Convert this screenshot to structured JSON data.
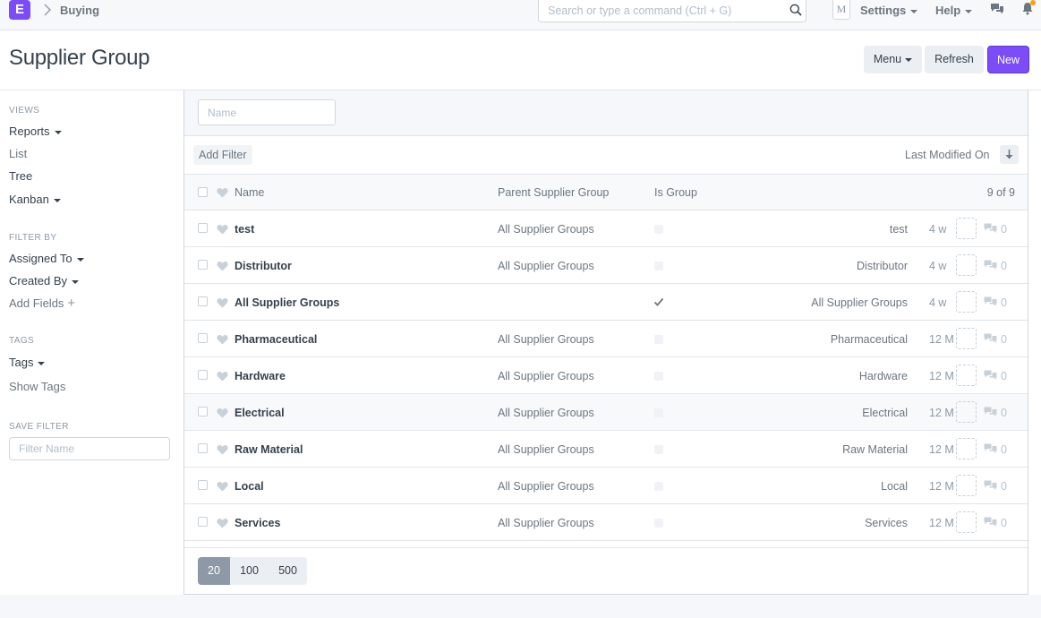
{
  "navbar": {
    "logo_letter": "E",
    "breadcrumb": "Buying",
    "search_placeholder": "Search or type a command (Ctrl + G)",
    "avatar_initial": "M",
    "settings_label": "Settings",
    "help_label": "Help"
  },
  "page": {
    "title": "Supplier Group",
    "menu_label": "Menu",
    "refresh_label": "Refresh",
    "new_label": "New"
  },
  "sidebar": {
    "views_heading": "VIEWS",
    "reports": "Reports",
    "list": "List",
    "tree": "Tree",
    "kanban": "Kanban",
    "filter_heading": "FILTER BY",
    "assigned_to": "Assigned To",
    "created_by": "Created By",
    "add_fields": "Add Fields",
    "tags_heading": "TAGS",
    "tags": "Tags",
    "show_tags": "Show Tags",
    "save_filter_heading": "SAVE FILTER",
    "filter_name_placeholder": "Filter Name"
  },
  "list": {
    "name_filter_placeholder": "Name",
    "add_filter": "Add Filter",
    "sort_label": "Last Modified On",
    "columns": {
      "name": "Name",
      "parent": "Parent Supplier Group",
      "is_group": "Is Group",
      "count": "9 of 9"
    },
    "rows": [
      {
        "name": "test",
        "parent": "All Supplier Groups",
        "is_group": false,
        "title": "test",
        "modified": "4 w",
        "comments": "0"
      },
      {
        "name": "Distributor",
        "parent": "All Supplier Groups",
        "is_group": false,
        "title": "Distributor",
        "modified": "4 w",
        "comments": "0"
      },
      {
        "name": "All Supplier Groups",
        "parent": "",
        "is_group": true,
        "title": "All Supplier Groups",
        "modified": "4 w",
        "comments": "0"
      },
      {
        "name": "Pharmaceutical",
        "parent": "All Supplier Groups",
        "is_group": false,
        "title": "Pharmaceutical",
        "modified": "12 M",
        "comments": "0"
      },
      {
        "name": "Hardware",
        "parent": "All Supplier Groups",
        "is_group": false,
        "title": "Hardware",
        "modified": "12 M",
        "comments": "0"
      },
      {
        "name": "Electrical",
        "parent": "All Supplier Groups",
        "is_group": false,
        "title": "Electrical",
        "modified": "12 M",
        "comments": "0"
      },
      {
        "name": "Raw Material",
        "parent": "All Supplier Groups",
        "is_group": false,
        "title": "Raw Material",
        "modified": "12 M",
        "comments": "0"
      },
      {
        "name": "Local",
        "parent": "All Supplier Groups",
        "is_group": false,
        "title": "Local",
        "modified": "12 M",
        "comments": "0"
      },
      {
        "name": "Services",
        "parent": "All Supplier Groups",
        "is_group": false,
        "title": "Services",
        "modified": "12 M",
        "comments": "0"
      }
    ],
    "page_sizes": [
      "20",
      "100",
      "500"
    ],
    "selected_page_size": "20"
  },
  "colors": {
    "brand": "#7b4cf8",
    "notification_dot": "#ffa00a"
  }
}
